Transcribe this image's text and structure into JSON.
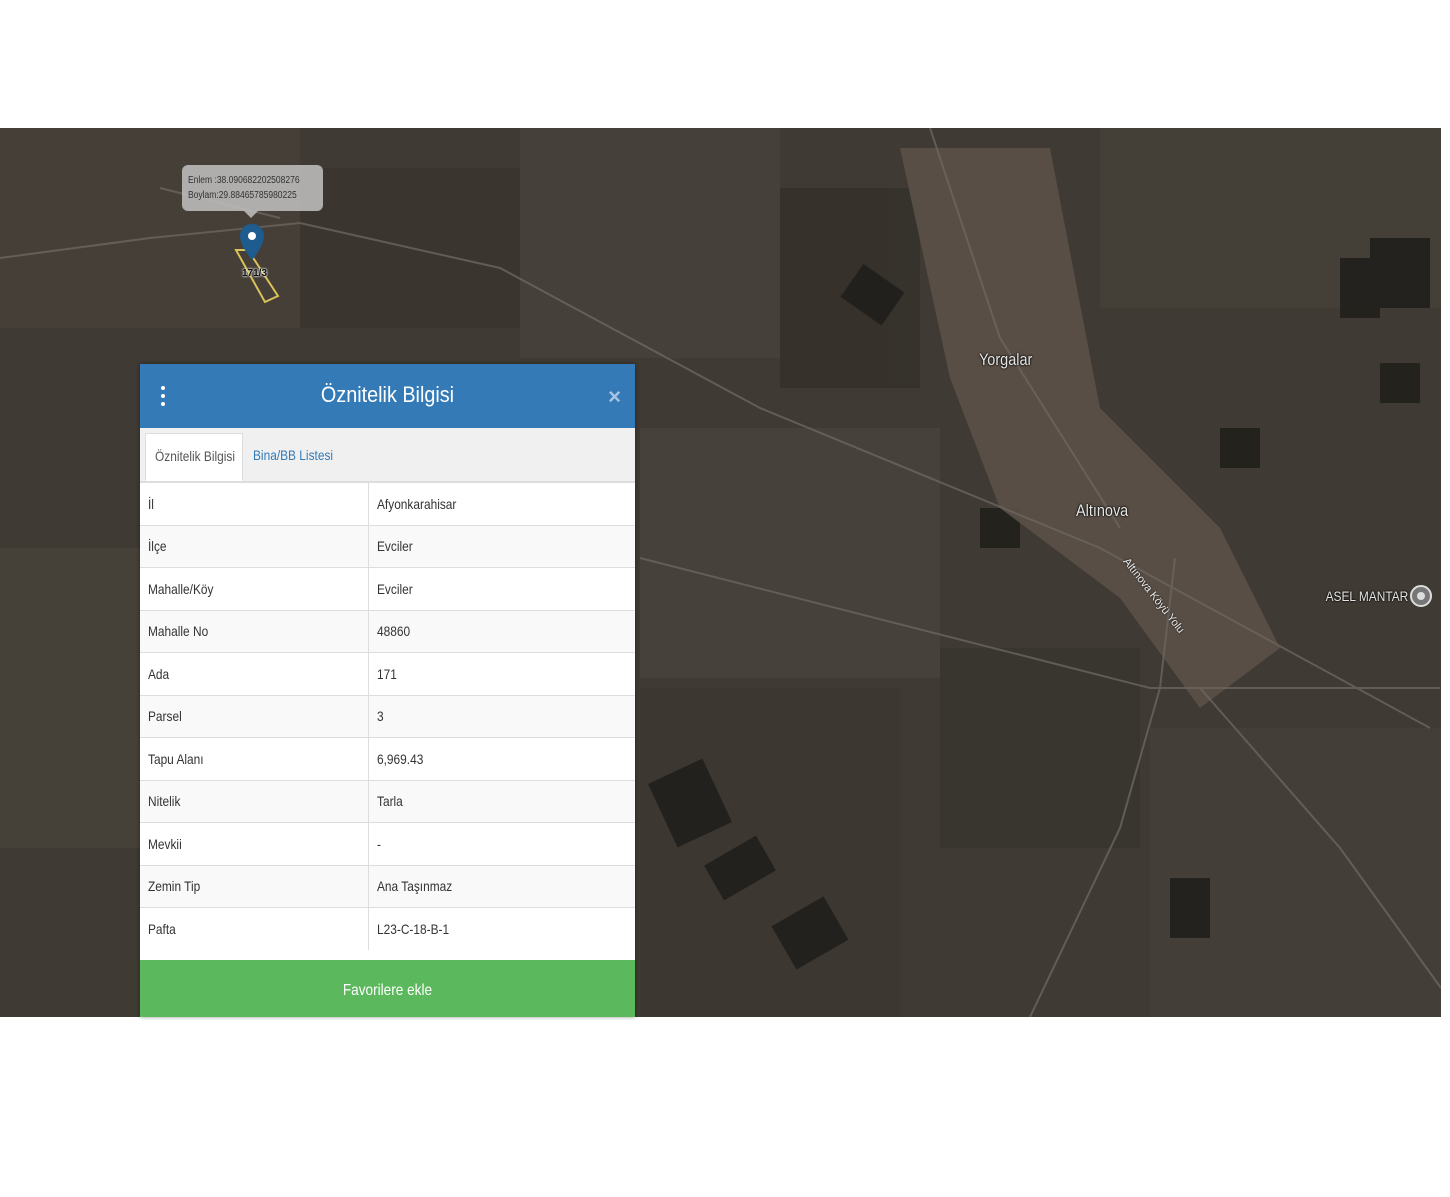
{
  "map": {
    "places": [
      "Yorgalar",
      "Altınova"
    ],
    "road_label": "Altınova Köyü Yolu",
    "poi_label": "ASEL MANTAR",
    "coordinate_tooltip": {
      "lat": "Enlem :38.090682202508276",
      "lon": "Boylam:29.88465785980225"
    },
    "parcel_label": "171/3",
    "colors": {
      "satellite_base": "#3f3a33",
      "parcel_outline": "#d9c25a",
      "pin": "#1e5b8e"
    }
  },
  "panel": {
    "title": "Öznitelik Bilgisi",
    "tabs": [
      "Öznitelik Bilgisi",
      "Bina/BB Listesi"
    ],
    "rows": [
      {
        "key": "İl",
        "value": "Afyonkarahisar"
      },
      {
        "key": "İlçe",
        "value": "Evciler"
      },
      {
        "key": "Mahalle/Köy",
        "value": "Evciler"
      },
      {
        "key": "Mahalle No",
        "value": "48860"
      },
      {
        "key": "Ada",
        "value": "171"
      },
      {
        "key": "Parsel",
        "value": "3"
      },
      {
        "key": "Tapu Alanı",
        "value": "6,969.43"
      },
      {
        "key": "Nitelik",
        "value": "Tarla"
      },
      {
        "key": "Mevkii",
        "value": "-"
      },
      {
        "key": "Zemin Tip",
        "value": "Ana Taşınmaz"
      },
      {
        "key": "Pafta",
        "value": "L23-C-18-B-1"
      }
    ],
    "favorite_button": "Favorilere ekle",
    "colors": {
      "header": "#337ab7",
      "button": "#5cb85c"
    }
  }
}
